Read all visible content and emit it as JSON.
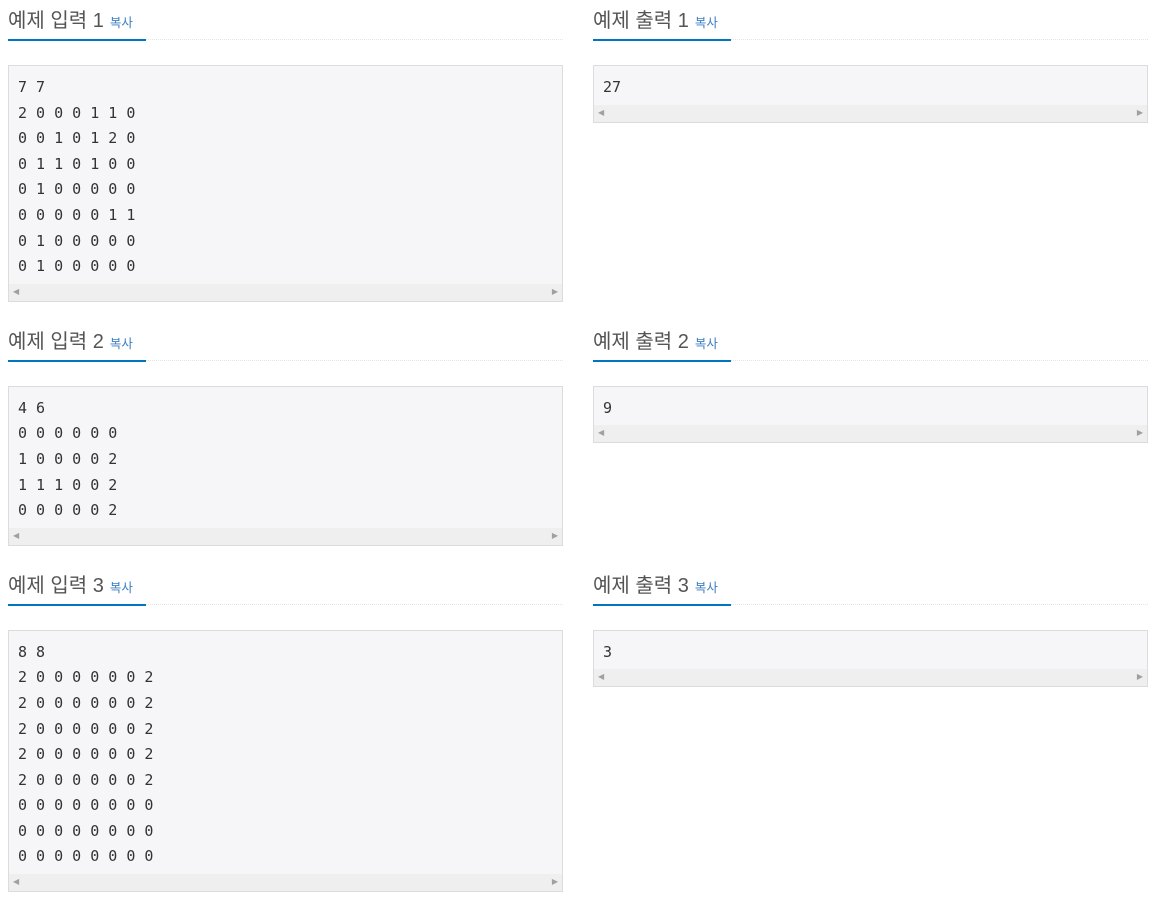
{
  "copy_label": "복사",
  "rows": [
    {
      "input": {
        "title": "예제 입력 1",
        "content": "7 7\n2 0 0 0 1 1 0\n0 0 1 0 1 2 0\n0 1 1 0 1 0 0\n0 1 0 0 0 0 0\n0 0 0 0 0 1 1\n0 1 0 0 0 0 0\n0 1 0 0 0 0 0"
      },
      "output": {
        "title": "예제 출력 1",
        "content": "27"
      }
    },
    {
      "input": {
        "title": "예제 입력 2",
        "content": "4 6\n0 0 0 0 0 0\n1 0 0 0 0 2\n1 1 1 0 0 2\n0 0 0 0 0 2"
      },
      "output": {
        "title": "예제 출력 2",
        "content": "9"
      }
    },
    {
      "input": {
        "title": "예제 입력 3",
        "content": "8 8\n2 0 0 0 0 0 0 2\n2 0 0 0 0 0 0 2\n2 0 0 0 0 0 0 2\n2 0 0 0 0 0 0 2\n2 0 0 0 0 0 0 2\n0 0 0 0 0 0 0 0\n0 0 0 0 0 0 0 0\n0 0 0 0 0 0 0 0"
      },
      "output": {
        "title": "예제 출력 3",
        "content": "3"
      }
    }
  ]
}
